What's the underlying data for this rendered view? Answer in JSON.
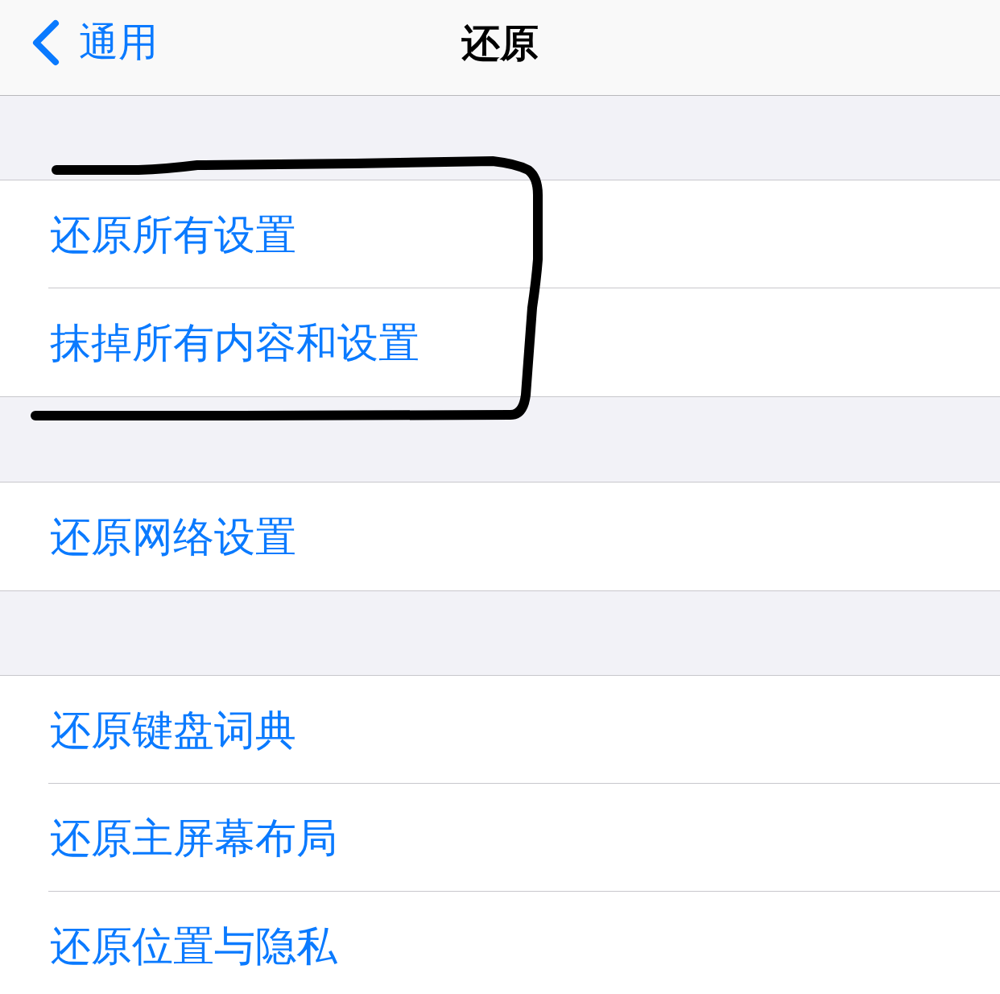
{
  "nav_bar": {
    "back_label": "通用",
    "title": "还原"
  },
  "groups": [
    {
      "items": [
        {
          "label": "还原所有设置"
        },
        {
          "label": "抹掉所有内容和设置"
        }
      ]
    },
    {
      "items": [
        {
          "label": "还原网络设置"
        }
      ]
    },
    {
      "items": [
        {
          "label": "还原键盘词典"
        },
        {
          "label": "还原主屏幕布局"
        },
        {
          "label": "还原位置与隐私"
        }
      ]
    }
  ]
}
